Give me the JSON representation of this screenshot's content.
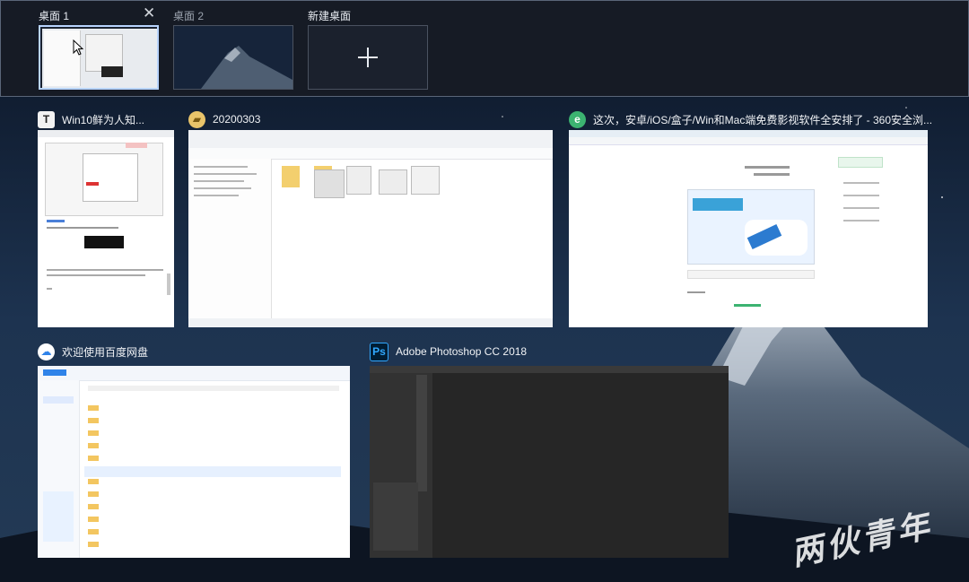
{
  "desktops": [
    {
      "label": "桌面 1",
      "active": true
    },
    {
      "label": "桌面 2",
      "active": false
    },
    {
      "label": "新建桌面",
      "active": false
    }
  ],
  "icons": {
    "close": "close-icon",
    "new_desktop": "plus-icon"
  },
  "windows": [
    {
      "title": "Win10鲜为人知...",
      "icon": "T",
      "app": "typora"
    },
    {
      "title": "20200303",
      "icon": "folder",
      "app": "file-explorer"
    },
    {
      "title": "这次，安卓/iOS/盒子/Win和Mac端免费影视软件全安排了 - 360安全浏...",
      "icon": "e",
      "app": "360-browser"
    },
    {
      "title": "欢迎使用百度网盘",
      "icon": "cloud",
      "app": "baidu-netdisk"
    },
    {
      "title": "Adobe Photoshop CC 2018",
      "icon": "Ps",
      "app": "photoshop"
    }
  ],
  "watermark": "两伙青年",
  "colors": {
    "desktop_bar": "#161b25",
    "active_border": "#b8d4ff",
    "ps_icon": "#31a8ff",
    "browser_icon": "#3cb371"
  }
}
